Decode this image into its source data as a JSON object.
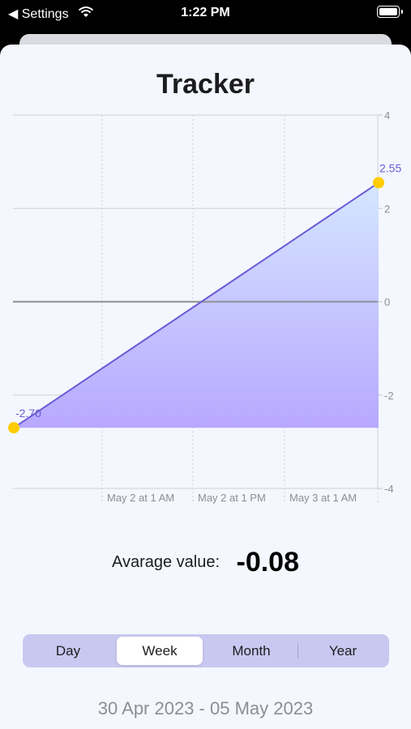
{
  "status_bar": {
    "back_label": "◀ Settings",
    "time": "1:22 PM"
  },
  "title": "Tracker",
  "chart_data": {
    "type": "area",
    "x_labels": [
      "May 2 at 1 AM",
      "May 2 at 1 PM",
      "May 3 at 1 AM"
    ],
    "y_ticks": [
      "4",
      "2",
      "0",
      "-2",
      "-4"
    ],
    "ylim": [
      -4,
      4
    ],
    "points": [
      {
        "label": "-2.70",
        "y": -2.7
      },
      {
        "label": "2.55",
        "y": 2.55
      }
    ],
    "grid": true,
    "colors": {
      "line": "#6b5bd6",
      "point": "#ffcc00",
      "fill_top": "#d4e6ff",
      "fill_bottom": "#b8a8ff"
    }
  },
  "average": {
    "label": "Avarage value:",
    "value": "-0.08"
  },
  "segments": [
    {
      "label": "Day",
      "selected": false
    },
    {
      "label": "Week",
      "selected": true
    },
    {
      "label": "Month",
      "selected": false
    },
    {
      "label": "Year",
      "selected": false
    }
  ],
  "date_range": "30 Apr 2023 - 05 May 2023"
}
